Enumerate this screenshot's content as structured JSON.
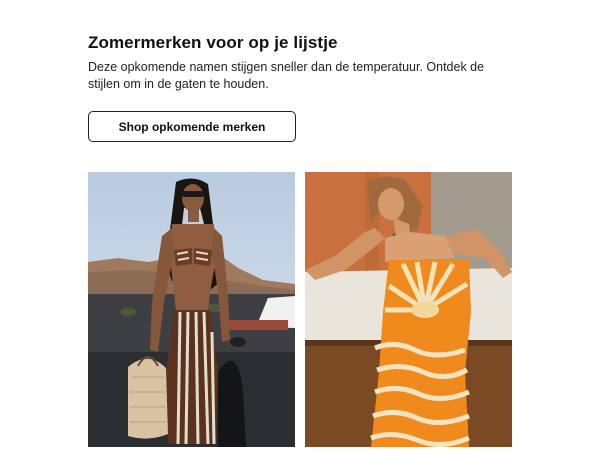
{
  "section": {
    "title": "Zomermerken voor op je lijstje",
    "description": "Deze opkomende namen stijgen sneller dan de temperatuur. Ontdek de stijlen om in de gaten te houden.",
    "cta_label": "Shop opkomende merken"
  }
}
